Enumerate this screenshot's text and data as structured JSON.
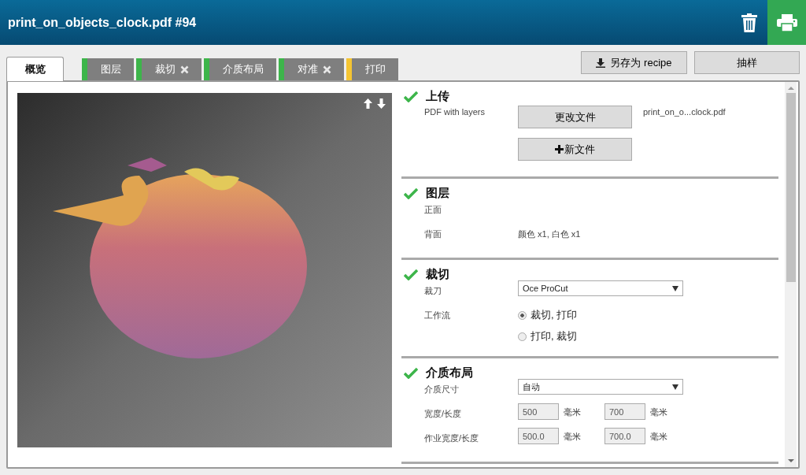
{
  "header": {
    "title": "print_on_objects_clock.pdf #94"
  },
  "tabs": [
    {
      "label": "概览",
      "selected": true
    },
    {
      "label": "图层",
      "selected": false,
      "color": "#3db54a",
      "removable": false
    },
    {
      "label": "裁切",
      "selected": false,
      "color": "#3db54a",
      "removable": true
    },
    {
      "label": "介质布局",
      "selected": false,
      "color": "#3db54a",
      "removable": false
    },
    {
      "label": "对准",
      "selected": false,
      "color": "#3db54a",
      "removable": true
    },
    {
      "label": "打印",
      "selected": false,
      "color": "#f5c532",
      "removable": false
    }
  ],
  "actions": [
    {
      "label": "另存为 recipe",
      "kind": "download"
    },
    {
      "label": "抽样",
      "kind": "plain"
    }
  ],
  "sections": [
    {
      "title": "上传",
      "done": true,
      "rows": [
        {
          "kind": "file",
          "label": "PDF with layers",
          "button": "更改文件",
          "value": "print_on_o...clock.pdf"
        },
        {
          "kind": "button",
          "button": "新文件"
        }
      ]
    },
    {
      "title": "图层",
      "done": true,
      "rows": [
        {
          "kind": "text",
          "label": "正面"
        },
        {
          "kind": "text",
          "label": "背面",
          "value": "颜色 x1, 白色 x1"
        }
      ]
    },
    {
      "title": "裁切",
      "done": true,
      "rows": [
        {
          "kind": "select",
          "label": "裁刀",
          "value": "Oce ProCut"
        },
        {
          "kind": "radio",
          "label": "工作流",
          "options": [
            {
              "label": "裁切, 打印",
              "selected": true
            },
            {
              "label": "打印, 裁切",
              "selected": false
            }
          ]
        }
      ]
    },
    {
      "title": "介质布局",
      "done": true,
      "rows": [
        {
          "kind": "select",
          "label": "介质尺寸",
          "value": "自动"
        },
        {
          "kind": "size",
          "label": "宽度/长度",
          "fields": [
            {
              "value": "500",
              "unit": "毫米"
            },
            {
              "value": "700",
              "unit": "毫米"
            }
          ]
        },
        {
          "kind": "size",
          "label": "作业宽度/长度",
          "fields": [
            {
              "value": "500.0",
              "unit": "毫米"
            },
            {
              "value": "700.0",
              "unit": "毫米"
            }
          ]
        }
      ]
    }
  ]
}
